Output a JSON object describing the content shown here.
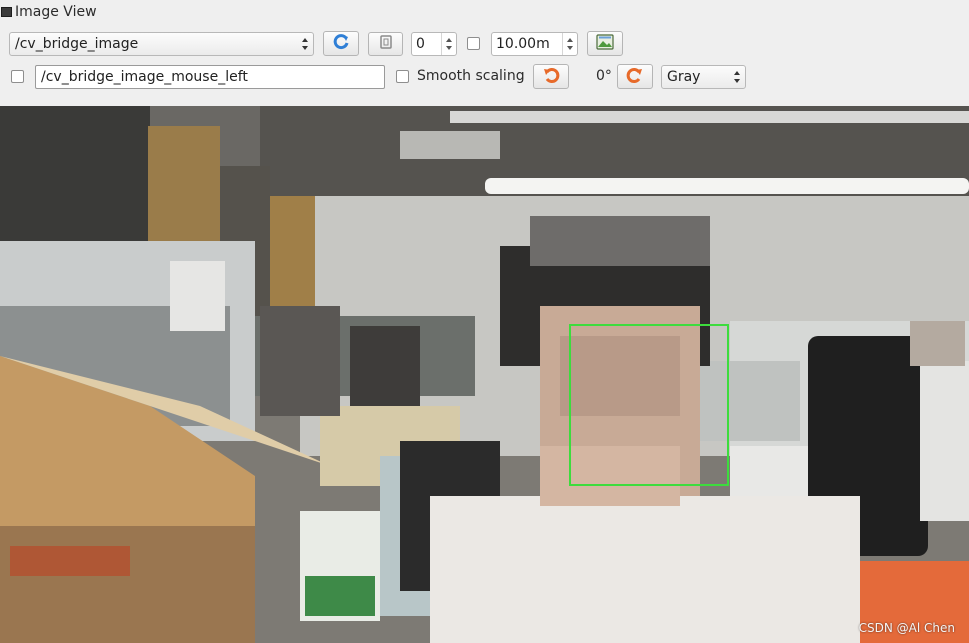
{
  "window": {
    "title": "Image View"
  },
  "toolbar": {
    "topic": "/cv_bridge_image",
    "spin_value": "0",
    "duration": "10.00m",
    "mouse_topic": "/cv_bridge_image_mouse_left",
    "smooth_scaling_label": "Smooth scaling",
    "rotation": "0°",
    "color_scheme": "Gray"
  },
  "icons": {
    "refresh": "refresh-icon",
    "ratio": "aspect-ratio-icon",
    "save": "save-image-icon",
    "rotate_left": "rotate-left-icon",
    "rotate_right": "rotate-right-icon"
  },
  "image": {
    "watermark": "CSDN @Al Chen",
    "face_box_color": "#3ddc3d"
  },
  "colors": {
    "accent": "#e76a2a",
    "refresh_blue": "#2f7fd6"
  }
}
